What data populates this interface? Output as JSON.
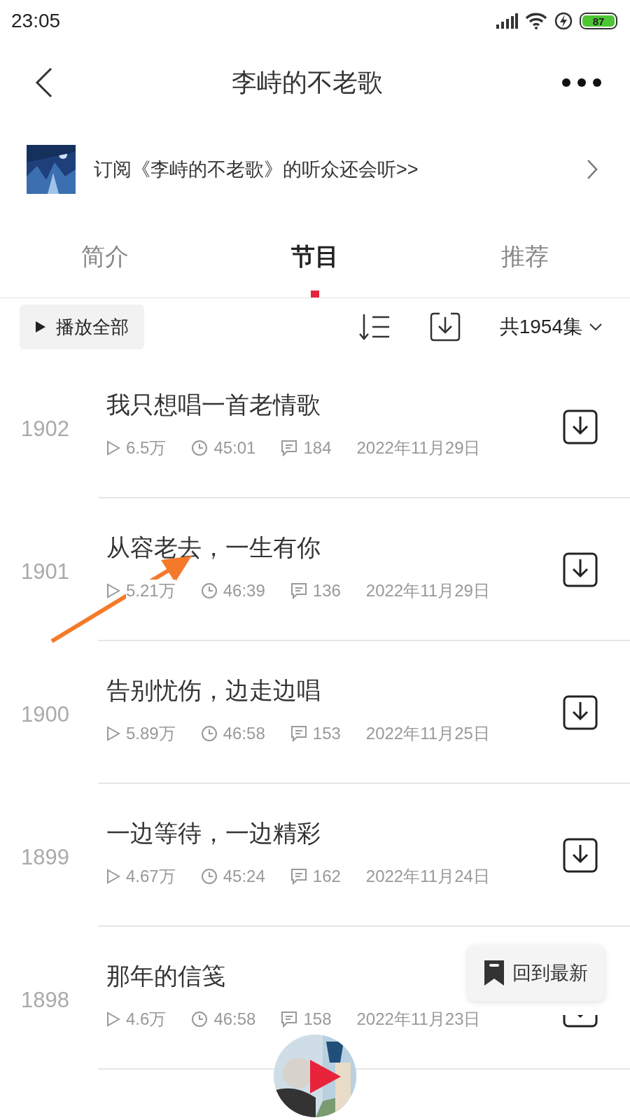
{
  "status_bar": {
    "time": "23:05",
    "battery": "87"
  },
  "header": {
    "title": "李峙的不老歌"
  },
  "promo": {
    "text": "订阅《李峙的不老歌》的听众还会听>>"
  },
  "tabs": [
    {
      "label": "简介",
      "selected": false
    },
    {
      "label": "节目",
      "selected": true
    },
    {
      "label": "推荐",
      "selected": false
    }
  ],
  "toolbar": {
    "play_all": "播放全部",
    "count": "共1954集"
  },
  "episodes": [
    {
      "number": "1902",
      "title": "我只想唱一首老情歌",
      "plays": "6.5万",
      "duration": "45:01",
      "comments": "184",
      "date": "2022年11月29日"
    },
    {
      "number": "1901",
      "title": "从容老去，一生有你",
      "plays": "5.21万",
      "duration": "46:39",
      "comments": "136",
      "date": "2022年11月29日"
    },
    {
      "number": "1900",
      "title": "告别忧伤，边走边唱",
      "plays": "5.89万",
      "duration": "46:58",
      "comments": "153",
      "date": "2022年11月25日"
    },
    {
      "number": "1899",
      "title": "一边等待，一边精彩",
      "plays": "4.67万",
      "duration": "45:24",
      "comments": "162",
      "date": "2022年11月24日"
    },
    {
      "number": "1898",
      "title": "那年的信笺",
      "plays": "4.6万",
      "duration": "46:58",
      "comments": "158",
      "date": "2022年11月23日"
    }
  ],
  "float_button": {
    "label": "回到最新"
  }
}
